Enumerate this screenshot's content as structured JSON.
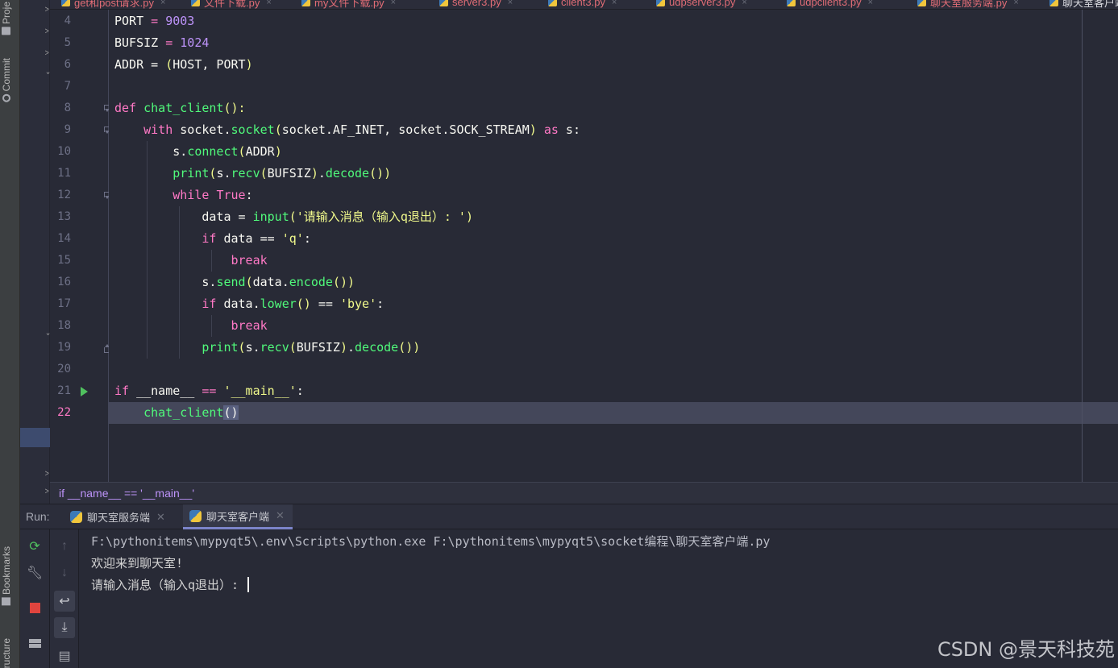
{
  "tool_strip": {
    "project_label": "Proje",
    "commit_label": "Commit",
    "bookmarks_label": "Bookmarks",
    "structure_label": "Structure"
  },
  "tabs": [
    {
      "label": "get和post请求.py"
    },
    {
      "label": "文件下载.py"
    },
    {
      "label": "my文件下载.py"
    },
    {
      "label": "server3.py"
    },
    {
      "label": "client3.py"
    },
    {
      "label": "udpserver3.py"
    },
    {
      "label": "udpclient3.py"
    },
    {
      "label": "聊天室服务端.py"
    },
    {
      "label": "聊天室客户端.py"
    }
  ],
  "editor": {
    "line_numbers": [
      "4",
      "5",
      "6",
      "7",
      "8",
      "9",
      "10",
      "11",
      "12",
      "13",
      "14",
      "15",
      "16",
      "17",
      "18",
      "19",
      "20",
      "21",
      "22"
    ],
    "current_line": "22",
    "code": {
      "l4a": "PORT",
      "l4b": " = ",
      "l4c": "9003",
      "l5a": "BUFSIZ",
      "l5b": " = ",
      "l5c": "1024",
      "l6a": "ADDR = ",
      "l6b": "(",
      "l6c": "HOST, PORT",
      "l6d": ")",
      "l8a": "def ",
      "l8b": "chat_client",
      "l8c": "():",
      "l9a": "    with ",
      "l9b": "socket.",
      "l9c": "socket",
      "l9d": "(",
      "l9e": "socket.AF_INET, socket.SOCK_STREAM",
      "l9f": ")",
      "l9g": " as ",
      "l9h": "s:",
      "l10a": "        s.",
      "l10b": "connect",
      "l10c": "(",
      "l10d": "ADDR",
      "l10e": ")",
      "l11a": "        ",
      "l11b": "print",
      "l11c": "(",
      "l11d": "s.",
      "l11e": "recv",
      "l11f": "(",
      "l11g": "BUFSIZ",
      "l11h": ")",
      "l11i": ".",
      "l11j": "decode",
      "l11k": "())",
      "l12a": "        while ",
      "l12b": "True",
      "l12c": ":",
      "l13a": "            data = ",
      "l13b": "input",
      "l13c": "(",
      "l13d": "'请输入消息（输入q退出）: '",
      "l13e": ")",
      "l14a": "            if ",
      "l14b": "data == ",
      "l14c": "'q'",
      "l14d": ":",
      "l15a": "                break",
      "l16a": "            s.",
      "l16b": "send",
      "l16c": "(",
      "l16d": "data.",
      "l16e": "encode",
      "l16f": "())",
      "l17a": "            if ",
      "l17b": "data.",
      "l17c": "lower",
      "l17d": "()",
      "l17e": " == ",
      "l17f": "'bye'",
      "l17g": ":",
      "l18a": "                break",
      "l19a": "            ",
      "l19b": "print",
      "l19c": "(",
      "l19d": "s.",
      "l19e": "recv",
      "l19f": "(",
      "l19g": "BUFSIZ",
      "l19h": ")",
      "l19i": ".",
      "l19j": "decode",
      "l19k": "())",
      "l21a": "if ",
      "l21b": "__name__",
      "l21c": " == ",
      "l21d": "'__main__'",
      "l21e": ":",
      "l22a": "    ",
      "l22b": "chat_client",
      "l22c": "()"
    }
  },
  "breadcrumb": "if __name__ == '__main__'",
  "run": {
    "label": "Run:",
    "tabs": [
      {
        "label": "聊天室服务端",
        "active": false
      },
      {
        "label": "聊天室客户端",
        "active": true
      }
    ],
    "console_lines": [
      "F:\\pythonitems\\mypyqt5\\.env\\Scripts\\python.exe F:\\pythonitems\\mypyqt5\\socket编程\\聊天室客户端.py",
      "欢迎来到聊天室!",
      "请输入消息（输入q退出）: "
    ]
  },
  "watermark": "CSDN @景天科技苑",
  "colors": {
    "keyword": "#ff79c6",
    "function": "#50fa7b",
    "number": "#bd93f9",
    "string": "#f1fa8c",
    "background": "#282a36"
  }
}
